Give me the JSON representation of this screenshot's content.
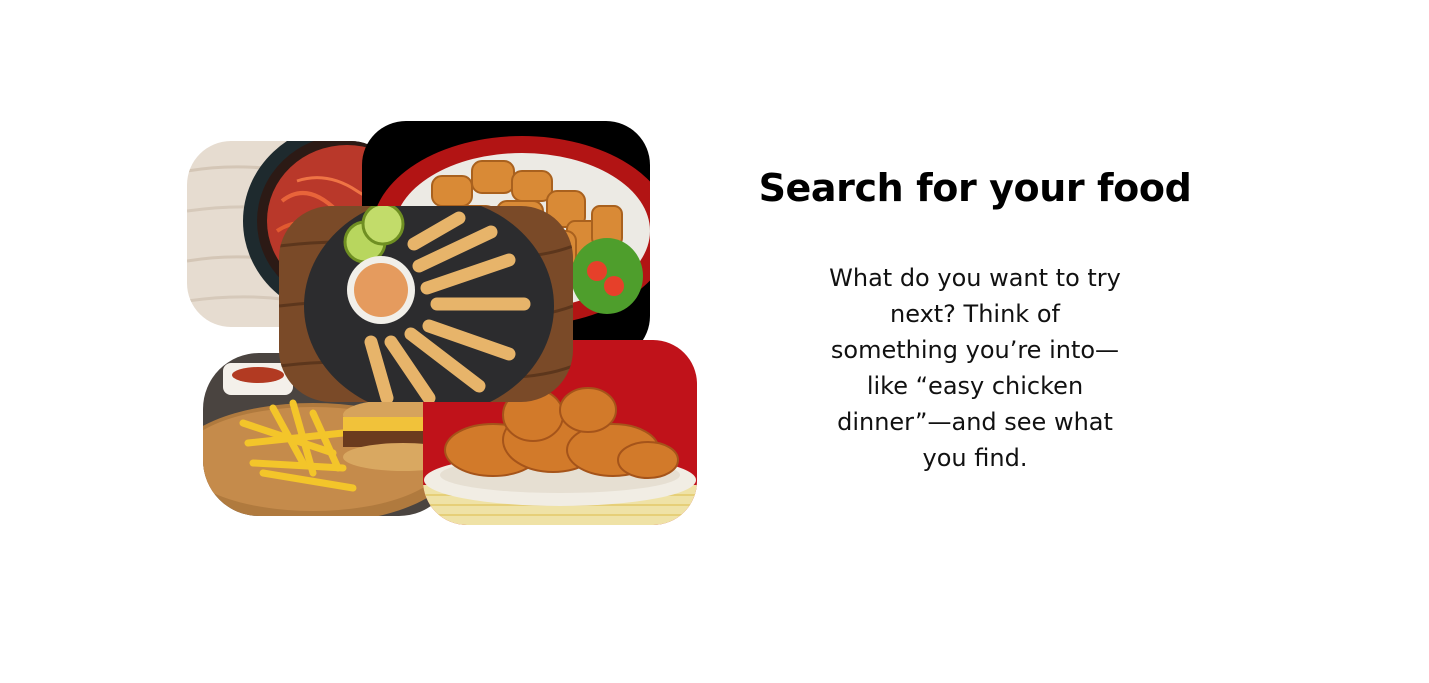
{
  "heading": "Search for your food",
  "description": "What do you want to try next? Think of something you’re into—like “easy chicken dinner”—and see what you find.",
  "colors": {
    "background": "#ffffff",
    "heading": "#000000",
    "body_text": "#111111"
  },
  "images": [
    {
      "name": "spaghetti-bowl-photo",
      "subject": "spaghetti bowl"
    },
    {
      "name": "fried-nuggets-photo",
      "subject": "fried nuggets platter"
    },
    {
      "name": "burger-fries-photo",
      "subject": "burger and fries"
    },
    {
      "name": "fried-chicken-photo",
      "subject": "fried chicken plate"
    },
    {
      "name": "fried-shrimp-photo",
      "subject": "fried shrimp with dip"
    }
  ]
}
